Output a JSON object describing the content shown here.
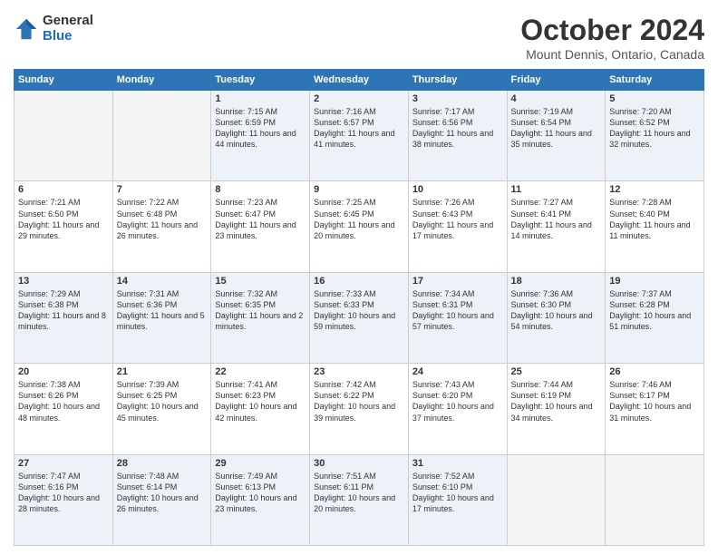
{
  "logo": {
    "general": "General",
    "blue": "Blue"
  },
  "header": {
    "month": "October 2024",
    "location": "Mount Dennis, Ontario, Canada"
  },
  "weekdays": [
    "Sunday",
    "Monday",
    "Tuesday",
    "Wednesday",
    "Thursday",
    "Friday",
    "Saturday"
  ],
  "weeks": [
    [
      {
        "day": "",
        "info": ""
      },
      {
        "day": "",
        "info": ""
      },
      {
        "day": "1",
        "info": "Sunrise: 7:15 AM\nSunset: 6:59 PM\nDaylight: 11 hours and 44 minutes."
      },
      {
        "day": "2",
        "info": "Sunrise: 7:16 AM\nSunset: 6:57 PM\nDaylight: 11 hours and 41 minutes."
      },
      {
        "day": "3",
        "info": "Sunrise: 7:17 AM\nSunset: 6:56 PM\nDaylight: 11 hours and 38 minutes."
      },
      {
        "day": "4",
        "info": "Sunrise: 7:19 AM\nSunset: 6:54 PM\nDaylight: 11 hours and 35 minutes."
      },
      {
        "day": "5",
        "info": "Sunrise: 7:20 AM\nSunset: 6:52 PM\nDaylight: 11 hours and 32 minutes."
      }
    ],
    [
      {
        "day": "6",
        "info": "Sunrise: 7:21 AM\nSunset: 6:50 PM\nDaylight: 11 hours and 29 minutes."
      },
      {
        "day": "7",
        "info": "Sunrise: 7:22 AM\nSunset: 6:48 PM\nDaylight: 11 hours and 26 minutes."
      },
      {
        "day": "8",
        "info": "Sunrise: 7:23 AM\nSunset: 6:47 PM\nDaylight: 11 hours and 23 minutes."
      },
      {
        "day": "9",
        "info": "Sunrise: 7:25 AM\nSunset: 6:45 PM\nDaylight: 11 hours and 20 minutes."
      },
      {
        "day": "10",
        "info": "Sunrise: 7:26 AM\nSunset: 6:43 PM\nDaylight: 11 hours and 17 minutes."
      },
      {
        "day": "11",
        "info": "Sunrise: 7:27 AM\nSunset: 6:41 PM\nDaylight: 11 hours and 14 minutes."
      },
      {
        "day": "12",
        "info": "Sunrise: 7:28 AM\nSunset: 6:40 PM\nDaylight: 11 hours and 11 minutes."
      }
    ],
    [
      {
        "day": "13",
        "info": "Sunrise: 7:29 AM\nSunset: 6:38 PM\nDaylight: 11 hours and 8 minutes."
      },
      {
        "day": "14",
        "info": "Sunrise: 7:31 AM\nSunset: 6:36 PM\nDaylight: 11 hours and 5 minutes."
      },
      {
        "day": "15",
        "info": "Sunrise: 7:32 AM\nSunset: 6:35 PM\nDaylight: 11 hours and 2 minutes."
      },
      {
        "day": "16",
        "info": "Sunrise: 7:33 AM\nSunset: 6:33 PM\nDaylight: 10 hours and 59 minutes."
      },
      {
        "day": "17",
        "info": "Sunrise: 7:34 AM\nSunset: 6:31 PM\nDaylight: 10 hours and 57 minutes."
      },
      {
        "day": "18",
        "info": "Sunrise: 7:36 AM\nSunset: 6:30 PM\nDaylight: 10 hours and 54 minutes."
      },
      {
        "day": "19",
        "info": "Sunrise: 7:37 AM\nSunset: 6:28 PM\nDaylight: 10 hours and 51 minutes."
      }
    ],
    [
      {
        "day": "20",
        "info": "Sunrise: 7:38 AM\nSunset: 6:26 PM\nDaylight: 10 hours and 48 minutes."
      },
      {
        "day": "21",
        "info": "Sunrise: 7:39 AM\nSunset: 6:25 PM\nDaylight: 10 hours and 45 minutes."
      },
      {
        "day": "22",
        "info": "Sunrise: 7:41 AM\nSunset: 6:23 PM\nDaylight: 10 hours and 42 minutes."
      },
      {
        "day": "23",
        "info": "Sunrise: 7:42 AM\nSunset: 6:22 PM\nDaylight: 10 hours and 39 minutes."
      },
      {
        "day": "24",
        "info": "Sunrise: 7:43 AM\nSunset: 6:20 PM\nDaylight: 10 hours and 37 minutes."
      },
      {
        "day": "25",
        "info": "Sunrise: 7:44 AM\nSunset: 6:19 PM\nDaylight: 10 hours and 34 minutes."
      },
      {
        "day": "26",
        "info": "Sunrise: 7:46 AM\nSunset: 6:17 PM\nDaylight: 10 hours and 31 minutes."
      }
    ],
    [
      {
        "day": "27",
        "info": "Sunrise: 7:47 AM\nSunset: 6:16 PM\nDaylight: 10 hours and 28 minutes."
      },
      {
        "day": "28",
        "info": "Sunrise: 7:48 AM\nSunset: 6:14 PM\nDaylight: 10 hours and 26 minutes."
      },
      {
        "day": "29",
        "info": "Sunrise: 7:49 AM\nSunset: 6:13 PM\nDaylight: 10 hours and 23 minutes."
      },
      {
        "day": "30",
        "info": "Sunrise: 7:51 AM\nSunset: 6:11 PM\nDaylight: 10 hours and 20 minutes."
      },
      {
        "day": "31",
        "info": "Sunrise: 7:52 AM\nSunset: 6:10 PM\nDaylight: 10 hours and 17 minutes."
      },
      {
        "day": "",
        "info": ""
      },
      {
        "day": "",
        "info": ""
      }
    ]
  ]
}
